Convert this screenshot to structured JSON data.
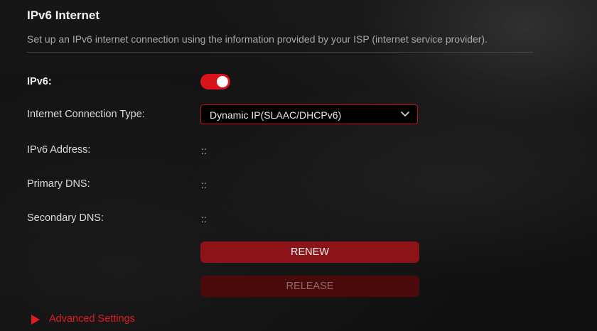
{
  "section": {
    "title": "IPv6 Internet",
    "description": "Set up an IPv6 internet connection using the information provided by your ISP (internet service provider)."
  },
  "fields": {
    "ipv6_label": "IPv6:",
    "ipv6_enabled": true,
    "connection_type_label": "Internet Connection Type:",
    "connection_type_value": "Dynamic IP(SLAAC/DHCPv6)",
    "ipv6_address_label": "IPv6 Address:",
    "ipv6_address_value": "::",
    "primary_dns_label": "Primary DNS:",
    "primary_dns_value": "::",
    "secondary_dns_label": "Secondary DNS:",
    "secondary_dns_value": "::"
  },
  "buttons": {
    "renew": "RENEW",
    "release": "RELEASE"
  },
  "advanced": {
    "label": "Advanced Settings"
  },
  "colors": {
    "accent": "#d9141d",
    "renew_bg": "#8c1317",
    "release_bg": "#4a0a0c"
  },
  "icons": {
    "dropdown": "chevron-down-icon",
    "advanced": "triangle-right-icon"
  }
}
